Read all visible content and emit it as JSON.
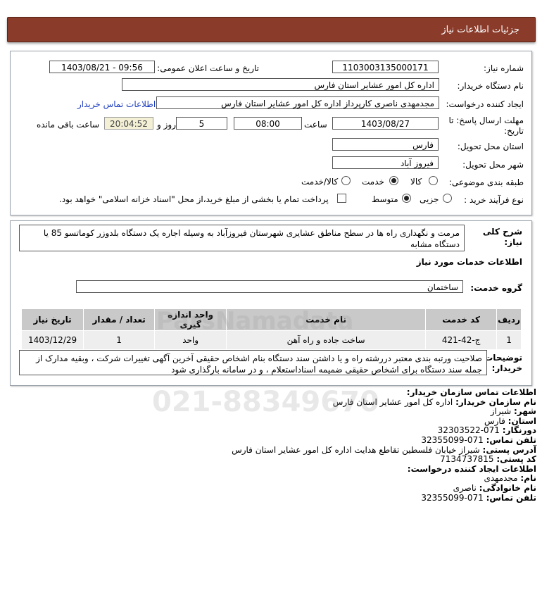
{
  "header": {
    "title": "جزئیات اطلاعات نیاز"
  },
  "form": {
    "need_number_label": "شماره نیاز:",
    "need_number": "1103003135000171",
    "announce_label": "تاریخ و ساعت اعلان عمومی:",
    "announce_value": "1403/08/21 - 09:56",
    "buyer_org_label": "نام دستگاه خریدار:",
    "buyer_org": "اداره کل امور عشایر استان فارس",
    "creator_label": "ایجاد کننده درخواست:",
    "creator": "مجدمهدی ناصری کارپرداز اداره کل امور عشایر استان فارس",
    "contact_link": "اطلاعات تماس خریدار",
    "deadline_label_1": "مهلت ارسال پاسخ: تا",
    "deadline_label_2": "تاریخ:",
    "deadline_date": "1403/08/27",
    "time_label": "ساعت",
    "deadline_time": "08:00",
    "days_value": "5",
    "days_label": "روز و",
    "remaining_time": "20:04:52",
    "remaining_label": "ساعت باقی مانده",
    "province_label": "استان محل تحویل:",
    "province": "فارس",
    "city_label": "شهر محل تحویل:",
    "city": "فیروز آباد",
    "category_label": "طبقه بندی موضوعی:",
    "category_options": [
      "کالا",
      "خدمت",
      "کالا/خدمت"
    ],
    "process_label": "نوع فرآیند خرید :",
    "process_options": [
      "جزیی",
      "متوسط"
    ],
    "payment_note": "پرداخت تمام یا بخشی از مبلغ خرید،از محل \"اسناد خزانه اسلامی\" خواهد بود."
  },
  "summary": {
    "label_1": "شرح کلی",
    "label_2": "نیاز:",
    "text": "مرمت و نگهداری راه ها در سطح مناطق عشایری شهرستان فیروزآباد به وسیله اجاره یک دستگاه بلدوزر کوماتسو 85 یا دستگاه مشابه",
    "services_title": "اطلاعات خدمات مورد نیاز",
    "service_group_label": "گروه خدمت:",
    "service_group": "ساختمان"
  },
  "table": {
    "headers": [
      "ردیف",
      "کد خدمت",
      "نام خدمت",
      "واحد اندازه گیری",
      "تعداد / مقدار",
      "تاریخ نیاز"
    ],
    "rows": [
      [
        "1",
        "ج-42-421",
        "ساخت جاده و راه آهن",
        "واحد",
        "1",
        "1403/12/29"
      ]
    ]
  },
  "notes": {
    "label_1": "توضیحات",
    "label_2": "خریدار:",
    "text": "صلاحیت ورتبه بندی معتبر دررشته راه و یا داشتن سند دستگاه بنام اشخاص حقیقی آخرین آگهی تغییرات شرکت ، وبقیه مدارک از جمله سند دستگاه برای اشخاص حقیقی ضمیمه اسناداستعلام ، و در سامانه بارگذاری شود"
  },
  "contact": {
    "title": "اطلاعات تماس سازمان خریدار:",
    "org_label": "نام سازمان خریدار:",
    "org": "اداره کل امور عشایر استان فارس",
    "city_label": "شهر:",
    "city": "شیراز",
    "province_label": "استان:",
    "province": "فارس",
    "fax_label": "دورنگار:",
    "fax": "071-32303522",
    "phone_label": "تلفن تماس:",
    "phone": "071-32355099",
    "address_label": "آدرس پستی:",
    "address": "شیراز خیابان فلسطین تقاطع هدایت اداره کل امور عشایر استان فارس",
    "postal_label": "کد پستی:",
    "postal": "7134737815",
    "creator_title": "اطلاعات ایجاد کننده درخواست:",
    "name_label": "نام:",
    "name": "مجدمهدی",
    "family_label": "نام خانوادگی:",
    "family": "ناصری",
    "creator_phone_label": "تلفن تماس:",
    "creator_phone": "071-32355099"
  },
  "watermark": {
    "brand": "ParsNamadata",
    "phone": "021-88349670"
  }
}
